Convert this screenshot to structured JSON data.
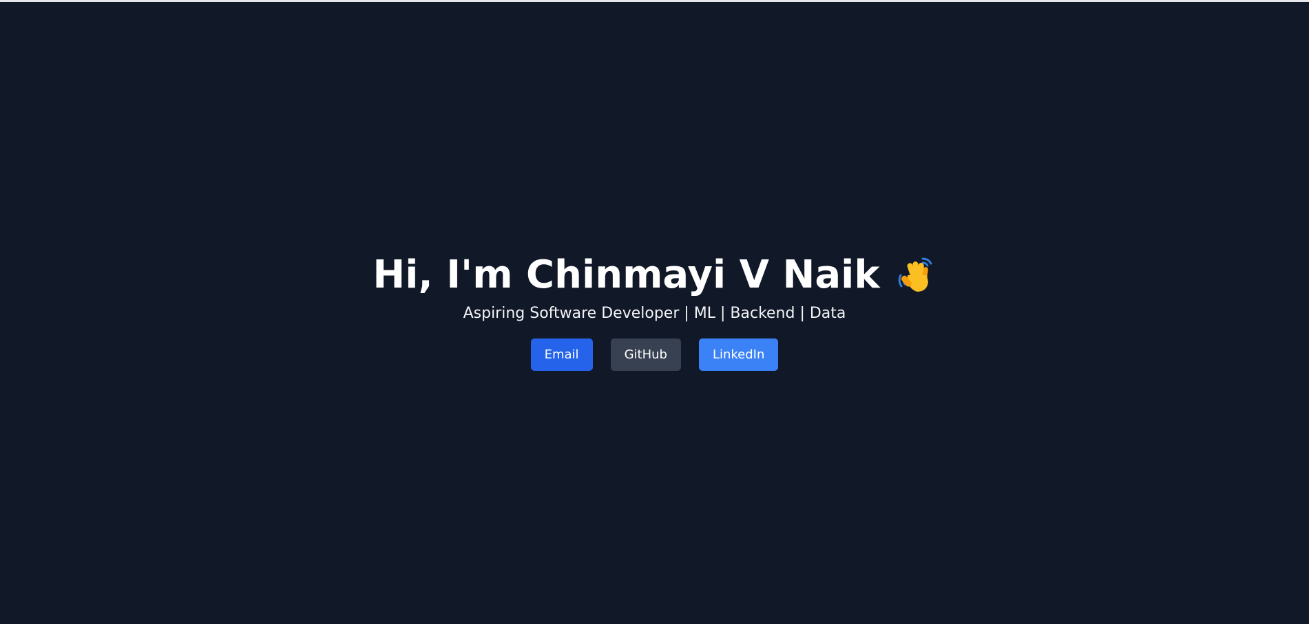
{
  "hero": {
    "greeting": "Hi, I'm Chinmayi V Naik",
    "subtitle": "Aspiring Software Developer | ML | Backend | Data",
    "emoji_icon": "waving-hand-icon"
  },
  "buttons": [
    {
      "label": "Email",
      "color": "#2563eb"
    },
    {
      "label": "GitHub",
      "color": "#374151"
    },
    {
      "label": "LinkedIn",
      "color": "#3b82f6"
    }
  ],
  "colors": {
    "background": "#111827",
    "text": "#ffffff"
  }
}
